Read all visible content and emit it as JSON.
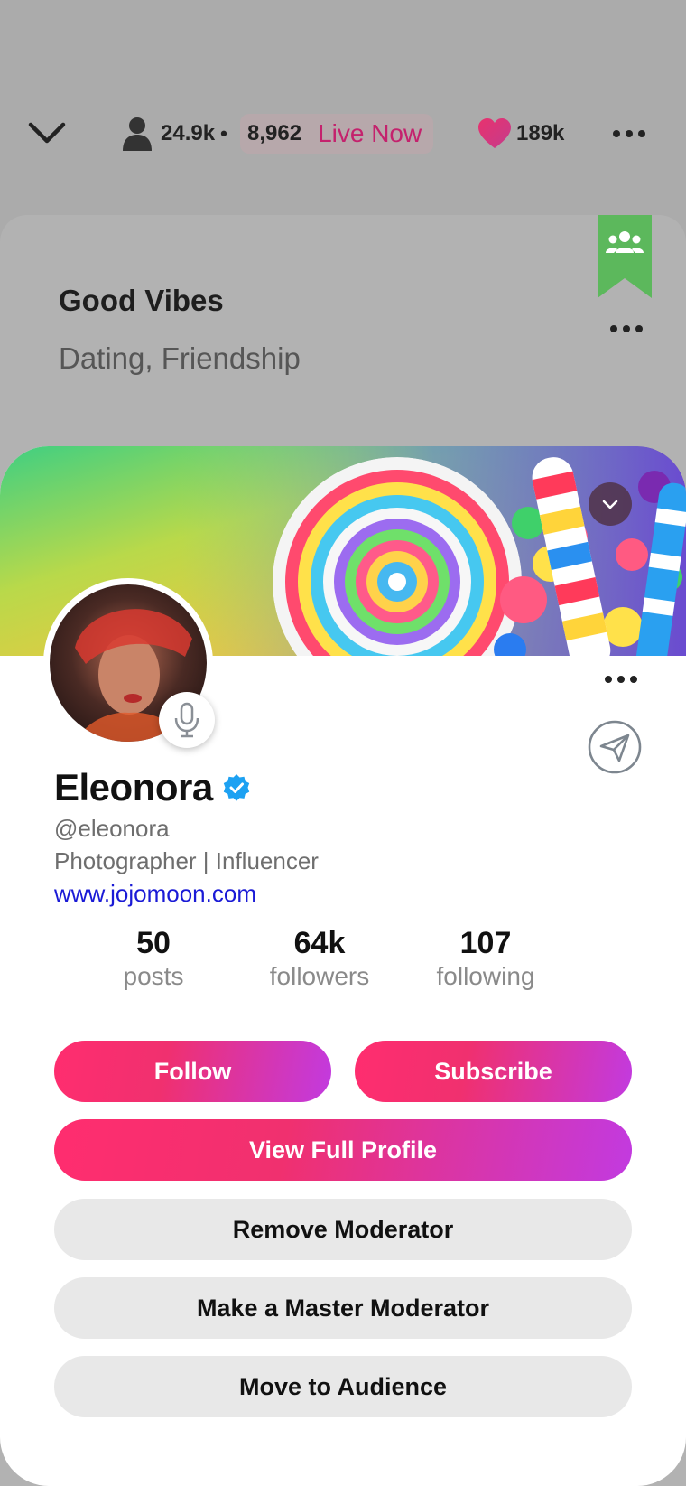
{
  "topbar": {
    "listeners": "24.9k",
    "separator": "•",
    "live_count": "8,962",
    "live_label": "Live Now",
    "likes": "189k"
  },
  "room": {
    "title": "Good Vibes",
    "tags": "Dating, Friendship"
  },
  "profile": {
    "name": "Eleonora",
    "handle": "@eleonora",
    "bio": "Photographer | Influencer",
    "website": "www.jojomoon.com",
    "stats": [
      {
        "value": "50",
        "label": "posts"
      },
      {
        "value": "64k",
        "label": "followers"
      },
      {
        "value": "107",
        "label": "following"
      }
    ]
  },
  "actions": {
    "follow": "Follow",
    "subscribe": "Subscribe",
    "view_full_profile": "View Full Profile",
    "remove_moderator": "Remove Moderator",
    "make_master_moderator": "Make a Master Moderator",
    "move_to_audience": "Move to Audience"
  },
  "colors": {
    "accent_start": "#ff2d6f",
    "accent_end": "#c23ae0",
    "live": "#c4226d",
    "verified": "#1da1f2",
    "bookmark": "#5cb85c",
    "link": "#1a1ad6"
  },
  "icons": {
    "collapse": "chevron-down-icon",
    "listeners": "person-icon",
    "likes": "heart-icon",
    "more": "more-icon",
    "bookmark": "group-bookmark-icon",
    "mic": "microphone-icon",
    "send": "send-icon",
    "verified": "verified-badge-icon"
  }
}
